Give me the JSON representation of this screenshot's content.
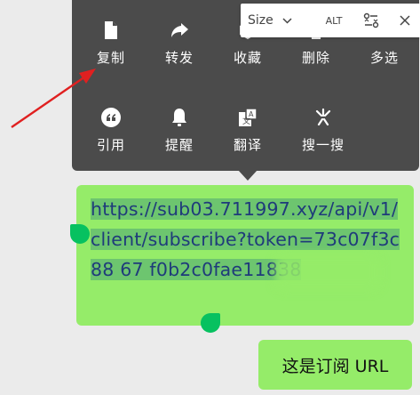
{
  "context_menu": {
    "row1": [
      {
        "label": "复制",
        "icon": "document-copy-icon"
      },
      {
        "label": "转发",
        "icon": "forward-arrow-icon"
      },
      {
        "label": "收藏",
        "icon": "favorite-cube-icon"
      },
      {
        "label": "删除",
        "icon": "trash-icon"
      },
      {
        "label": "多选",
        "icon": "checklist-icon"
      }
    ],
    "row2": [
      {
        "label": "引用",
        "icon": "quote-icon"
      },
      {
        "label": "提醒",
        "icon": "bell-icon"
      },
      {
        "label": "翻译",
        "icon": "translate-icon"
      },
      {
        "label": "搜一搜",
        "icon": "sparkle-search-icon"
      }
    ]
  },
  "toolbar": {
    "size_label": "Size",
    "alt_label": "ALT"
  },
  "message_link": {
    "text": "https://sub03.711997.xyz/api/v1/client/subscribe?token=73c07f3c88  67  f0b2c0fae11838"
  },
  "message_note": {
    "text": "这是订阅 URL"
  },
  "colors": {
    "menu_bg": "#4b4b4b",
    "bubble_green": "#95ec69",
    "handle_green": "#07c160",
    "link_text": "#1f3b7a",
    "arrow_red": "#e02020"
  }
}
